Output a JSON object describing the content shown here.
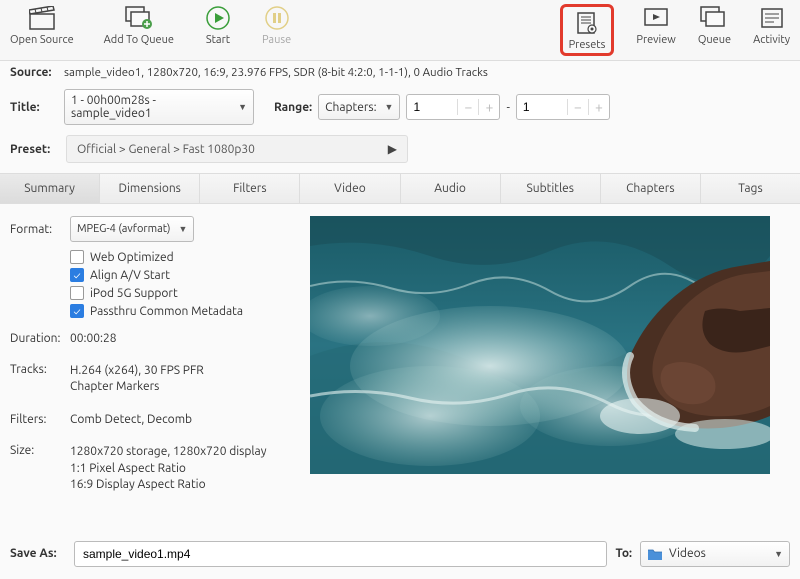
{
  "toolbar": {
    "open_source": "Open Source",
    "add_to_queue": "Add To Queue",
    "start": "Start",
    "pause": "Pause",
    "presets": "Presets",
    "preview": "Preview",
    "queue": "Queue",
    "activity": "Activity"
  },
  "source": {
    "label": "Source:",
    "value": "sample_video1, 1280x720, 16:9, 23.976 FPS, SDR (8-bit 4:2:0, 1-1-1), 0 Audio Tracks"
  },
  "title": {
    "label": "Title:",
    "value": "1 - 00h00m28s - sample_video1"
  },
  "range": {
    "label": "Range:",
    "mode": "Chapters:",
    "from": "1",
    "to": "1",
    "dash": "-"
  },
  "preset": {
    "label": "Preset:",
    "value": "Official > General > Fast 1080p30"
  },
  "tabs": [
    "Summary",
    "Dimensions",
    "Filters",
    "Video",
    "Audio",
    "Subtitles",
    "Chapters",
    "Tags"
  ],
  "active_tab": 0,
  "format": {
    "label": "Format:",
    "value": "MPEG-4 (avformat)"
  },
  "checkboxes": [
    {
      "label": "Web Optimized",
      "checked": false
    },
    {
      "label": "Align A/V Start",
      "checked": true
    },
    {
      "label": "iPod 5G Support",
      "checked": false
    },
    {
      "label": "Passthru Common Metadata",
      "checked": true
    }
  ],
  "meta": {
    "duration": {
      "label": "Duration:",
      "value": "00:00:28"
    },
    "tracks": {
      "label": "Tracks:",
      "lines": [
        "H.264 (x264), 30 FPS PFR",
        "Chapter Markers"
      ]
    },
    "filters": {
      "label": "Filters:",
      "value": "Comb Detect, Decomb"
    },
    "size": {
      "label": "Size:",
      "lines": [
        "1280x720 storage, 1280x720 display",
        "1:1 Pixel Aspect Ratio",
        "16:9 Display Aspect Ratio"
      ]
    }
  },
  "save": {
    "label": "Save As:",
    "value": "sample_video1.mp4",
    "to_label": "To:",
    "to_value": "Videos"
  }
}
